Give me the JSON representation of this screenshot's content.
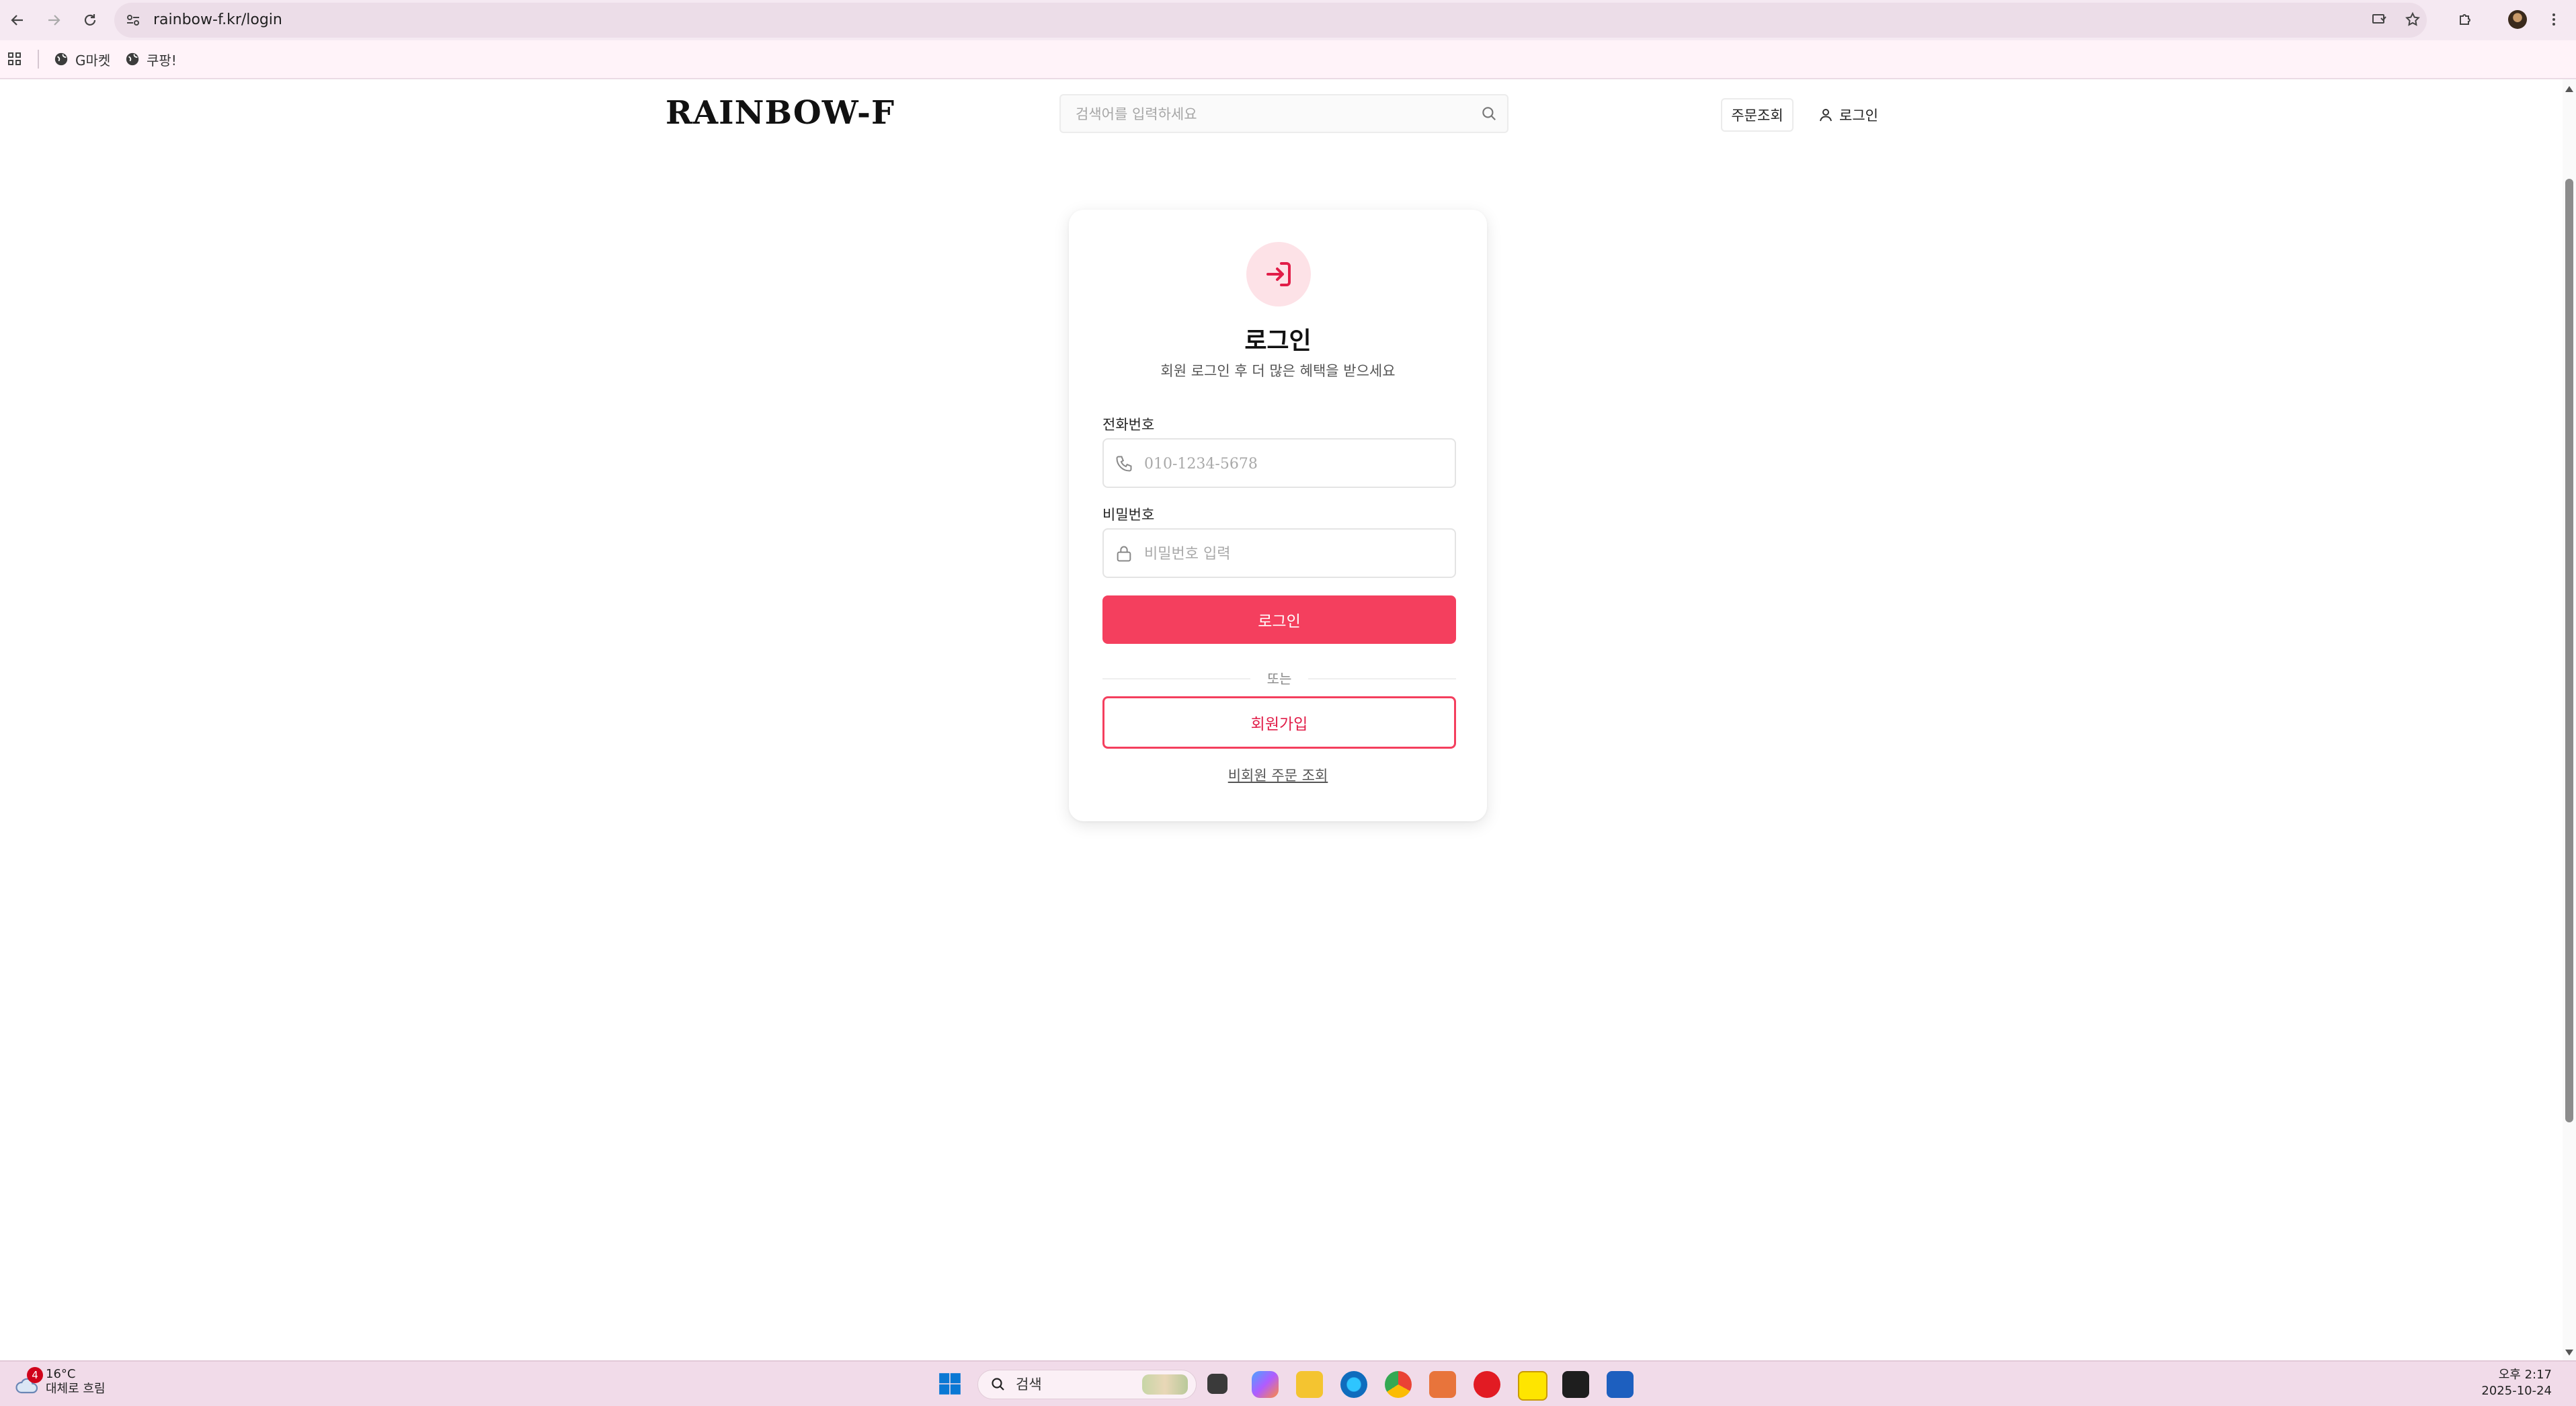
{
  "browser": {
    "url": "rainbow-f.kr/login",
    "bookmarks": [
      {
        "label": "G마켓",
        "icon": "globe-icon"
      },
      {
        "label": "쿠팡!",
        "icon": "globe-icon"
      }
    ]
  },
  "header": {
    "logo": "RAINBOW-F",
    "search_placeholder": "검색어를 입력하세요",
    "order_lookup": "주문조회",
    "login": "로그인"
  },
  "login_card": {
    "title": "로그인",
    "subtitle": "회원 로그인 후 더 많은 혜택을 받으세요",
    "phone_label": "전화번호",
    "phone_placeholder": "010-1234-5678",
    "password_label": "비밀번호",
    "password_placeholder": "비밀번호 입력",
    "login_button": "로그인",
    "divider": "또는",
    "signup_button": "회원가입",
    "guest_order_link": "비회원 주문 조회",
    "accent_color": "#f43f5e"
  },
  "taskbar": {
    "weather_badge": "4",
    "temperature": "16°C",
    "weather": "대체로 흐림",
    "search": "검색",
    "time": "오후 2:17",
    "date": "2025-10-24"
  }
}
